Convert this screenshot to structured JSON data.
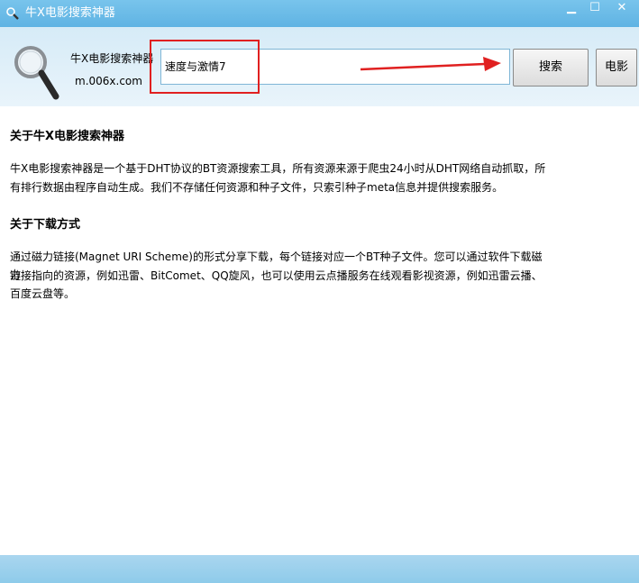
{
  "window": {
    "title": "牛X电影搜索神器",
    "controls": [
      "minimize-icon",
      "maximize-icon",
      "close-icon"
    ]
  },
  "header": {
    "app_name": "牛X电影搜索神器",
    "site": "m.006x.com",
    "logo_icon": "magnifier-icon"
  },
  "search": {
    "value": "速度与激情7",
    "button_label": "搜索",
    "movie_button_label": "电影"
  },
  "annotation": {
    "highlight_color": "#e02020",
    "arrow_icon": "arrow-right-icon"
  },
  "sections": [
    {
      "heading": "关于牛X电影搜索神器",
      "lines": [
        "牛X电影搜索神器是一个基于DHT协议的BT资源搜索工具，所有资源来源于爬虫24小时从DHT网络自动抓取，所",
        "有排行数据由程序自动生成。我们不存储任何资源和种子文件，只索引种子meta信息并提供搜索服务。"
      ]
    },
    {
      "heading": "关于下载方式",
      "lines": [
        "通过磁力链接(Magnet URI Scheme)的形式分享下载，每个链接对应一个BT种子文件。您可以通过软件下载磁力",
        "链接指向的资源，例如迅雷、BitComet、QQ旋风，也可以使用云点播服务在线观看影视资源，例如迅雷云播、",
        "百度云盘等。"
      ]
    }
  ]
}
